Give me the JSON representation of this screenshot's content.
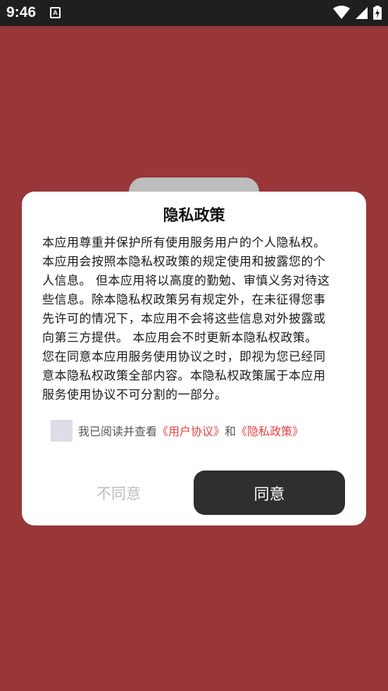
{
  "status_bar": {
    "time": "9:46",
    "notification_icon_letter": "A",
    "icons": [
      "wifi-icon",
      "cellular-signal-icon",
      "battery-charging-icon"
    ]
  },
  "dialog": {
    "title": "隐私政策",
    "body_lines": [
      "本应用尊重并保护所有使用服务用户的个人隐私权。",
      "本应用会按照本隐私权政策的规定使用和披露您的个",
      "人信息。 但本应用将以高度的勤勉、审慎义务对待这",
      "些信息。除本隐私权政策另有规定外，在未征得您事",
      "先许可的情况下，本应用不会将这些信息对外披露或",
      "向第三方提供。 本应用会不时更新本隐私权政策。",
      "您在同意本应用服务使用协议之时，即视为您已经同",
      "意本隐私权政策全部内容。本隐私权政策属于本应用",
      "服务使用协议不可分割的一部分。"
    ],
    "consent": {
      "prefix": "我已阅读并查看",
      "user_agreement_link": "《用户协议》",
      "conjunction": "和",
      "privacy_policy_link": "《隐私政策》",
      "checked": false
    },
    "disagree_label": "不同意",
    "agree_label": "同意"
  },
  "colors": {
    "background": "#983638",
    "dialog": "#ffffff",
    "agree_button": "#2f2f2f",
    "link": "#e34242",
    "disabled_text": "#bdbdbd"
  }
}
